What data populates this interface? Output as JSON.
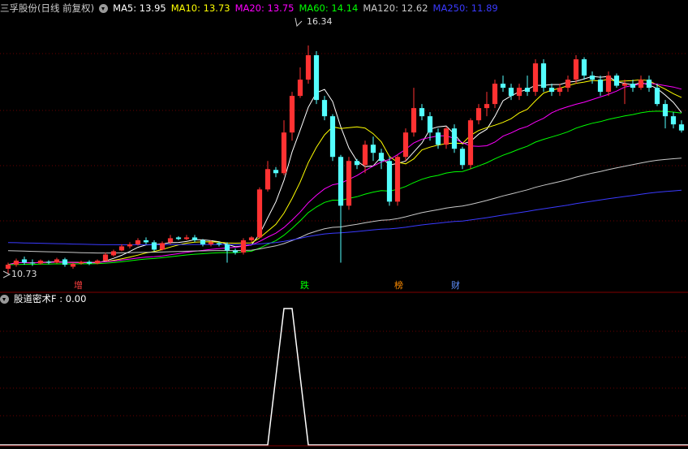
{
  "header": {
    "stock_label": "三孚股份(日线 前复权)",
    "ma_items": [
      {
        "label": "MA5: 13.95",
        "color": "#ffffff"
      },
      {
        "label": "MA10: 13.73",
        "color": "#ffff00"
      },
      {
        "label": "MA20: 13.75",
        "color": "#ff00ff"
      },
      {
        "label": "MA60: 14.14",
        "color": "#00ff00"
      },
      {
        "label": "MA120: 12.62",
        "color": "#c8c8c8"
      },
      {
        "label": "MA250: 11.89",
        "color": "#3a3aff"
      }
    ]
  },
  "annotations": {
    "high_label": "16.34",
    "low_label": "10.73"
  },
  "events": [
    {
      "text": "增",
      "color": "#ff4040"
    },
    {
      "text": "跌",
      "color": "#00ff00"
    },
    {
      "text": "榜",
      "color": "#ff8c00"
    },
    {
      "text": "财",
      "color": "#5f8fff"
    }
  ],
  "indicator": {
    "label": "股道密术F : 0.00",
    "color": "#ffffff"
  },
  "chart_data": [
    {
      "type": "candlestick",
      "ylim": [
        10.73,
        16.34
      ],
      "up_color": "#ff3232",
      "down_color": "#54ffff",
      "candles": [
        [
          10.85,
          10.95,
          10.73,
          11.0
        ],
        [
          10.95,
          11.05,
          10.9,
          11.1
        ],
        [
          11.08,
          11.0,
          10.95,
          11.15
        ],
        [
          11.0,
          10.98,
          10.92,
          11.08
        ],
        [
          10.98,
          11.05,
          10.95,
          11.08
        ],
        [
          11.02,
          11.0,
          10.96,
          11.06
        ],
        [
          11.0,
          11.08,
          10.98,
          11.12
        ],
        [
          11.08,
          10.95,
          10.9,
          11.12
        ],
        [
          10.9,
          10.97,
          10.85,
          11.0
        ],
        [
          10.98,
          11.02,
          10.95,
          11.05
        ],
        [
          11.02,
          10.98,
          10.94,
          11.06
        ],
        [
          10.98,
          11.05,
          10.96,
          11.08
        ],
        [
          11.05,
          11.2,
          11.03,
          11.25
        ],
        [
          11.18,
          11.28,
          11.15,
          11.32
        ],
        [
          11.3,
          11.4,
          11.28,
          11.45
        ],
        [
          11.4,
          11.45,
          11.35,
          11.5
        ],
        [
          11.45,
          11.55,
          11.42,
          11.6
        ],
        [
          11.55,
          11.5,
          11.45,
          11.62
        ],
        [
          11.5,
          11.32,
          11.28,
          11.55
        ],
        [
          11.32,
          11.48,
          11.3,
          11.52
        ],
        [
          11.5,
          11.6,
          11.45,
          11.68
        ],
        [
          11.62,
          11.58,
          11.55,
          11.65
        ],
        [
          11.58,
          11.62,
          11.55,
          11.68
        ],
        [
          11.62,
          11.55,
          11.5,
          11.68
        ],
        [
          11.55,
          11.45,
          11.4,
          11.58
        ],
        [
          11.45,
          11.5,
          11.4,
          11.55
        ],
        [
          11.48,
          11.45,
          11.4,
          11.52
        ],
        [
          11.45,
          11.3,
          11.0,
          11.5
        ],
        [
          11.3,
          11.25,
          11.2,
          11.35
        ],
        [
          11.25,
          11.55,
          11.2,
          11.6
        ],
        [
          11.55,
          11.62,
          11.5,
          11.65
        ],
        [
          11.62,
          12.8,
          11.6,
          12.85
        ],
        [
          12.8,
          13.3,
          12.75,
          13.5
        ],
        [
          13.28,
          13.2,
          13.1,
          13.35
        ],
        [
          13.2,
          14.2,
          13.15,
          14.5
        ],
        [
          14.2,
          15.1,
          14.0,
          15.2
        ],
        [
          15.1,
          15.5,
          15.05,
          15.8
        ],
        [
          15.5,
          16.1,
          15.4,
          16.34
        ],
        [
          16.1,
          15.0,
          14.9,
          16.2
        ],
        [
          15.0,
          14.6,
          14.5,
          15.1
        ],
        [
          14.6,
          13.6,
          13.5,
          14.65
        ],
        [
          13.6,
          12.4,
          11.0,
          13.65
        ],
        [
          12.4,
          13.5,
          12.3,
          13.6
        ],
        [
          13.5,
          13.4,
          13.3,
          13.55
        ],
        [
          13.4,
          13.9,
          13.2,
          14.0
        ],
        [
          13.9,
          13.7,
          13.5,
          14.1
        ],
        [
          13.7,
          13.5,
          13.3,
          13.8
        ],
        [
          13.5,
          12.5,
          12.4,
          13.6
        ],
        [
          12.5,
          13.6,
          12.4,
          13.65
        ],
        [
          13.6,
          14.2,
          13.5,
          14.3
        ],
        [
          14.2,
          14.8,
          14.1,
          15.3
        ],
        [
          14.8,
          14.6,
          14.5,
          14.9
        ],
        [
          14.6,
          14.2,
          14.0,
          14.7
        ],
        [
          14.2,
          13.9,
          13.8,
          14.3
        ],
        [
          13.9,
          14.3,
          13.8,
          14.35
        ],
        [
          14.3,
          13.8,
          13.7,
          14.4
        ],
        [
          13.8,
          13.4,
          13.3,
          13.85
        ],
        [
          13.4,
          14.5,
          13.3,
          14.55
        ],
        [
          14.5,
          14.8,
          14.4,
          14.9
        ],
        [
          14.8,
          14.9,
          14.6,
          15.2
        ],
        [
          14.9,
          15.4,
          14.8,
          15.5
        ],
        [
          15.4,
          15.3,
          15.2,
          15.6
        ],
        [
          15.3,
          15.1,
          15.0,
          15.4
        ],
        [
          15.1,
          15.3,
          15.0,
          15.4
        ],
        [
          15.3,
          15.2,
          15.1,
          15.6
        ],
        [
          15.2,
          15.9,
          15.1,
          16.0
        ],
        [
          15.9,
          15.3,
          15.2,
          16.0
        ],
        [
          15.3,
          15.2,
          15.1,
          15.4
        ],
        [
          15.2,
          15.3,
          15.1,
          15.4
        ],
        [
          15.3,
          15.5,
          15.2,
          15.6
        ],
        [
          15.5,
          16.0,
          15.4,
          16.1
        ],
        [
          16.0,
          15.6,
          15.5,
          16.05
        ],
        [
          15.6,
          15.5,
          15.4,
          15.7
        ],
        [
          15.5,
          15.2,
          15.1,
          15.6
        ],
        [
          15.2,
          15.6,
          15.1,
          15.7
        ],
        [
          15.6,
          15.35,
          15.3,
          15.65
        ],
        [
          15.35,
          15.4,
          14.9,
          15.5
        ],
        [
          15.4,
          15.3,
          15.2,
          15.5
        ],
        [
          15.3,
          15.5,
          15.25,
          15.6
        ],
        [
          15.5,
          15.3,
          15.2,
          15.6
        ],
        [
          15.3,
          14.9,
          14.85,
          15.4
        ],
        [
          14.9,
          14.6,
          14.3,
          15.0
        ],
        [
          14.6,
          14.4,
          14.3,
          14.7
        ],
        [
          14.4,
          14.25,
          14.2,
          14.5
        ]
      ]
    },
    {
      "type": "line",
      "series": [
        {
          "name": "股道密术F",
          "values": [
            0,
            1,
            1,
            0
          ]
        }
      ],
      "x_index": [
        32,
        34,
        35,
        37
      ],
      "ylim": [
        0,
        1
      ]
    }
  ]
}
